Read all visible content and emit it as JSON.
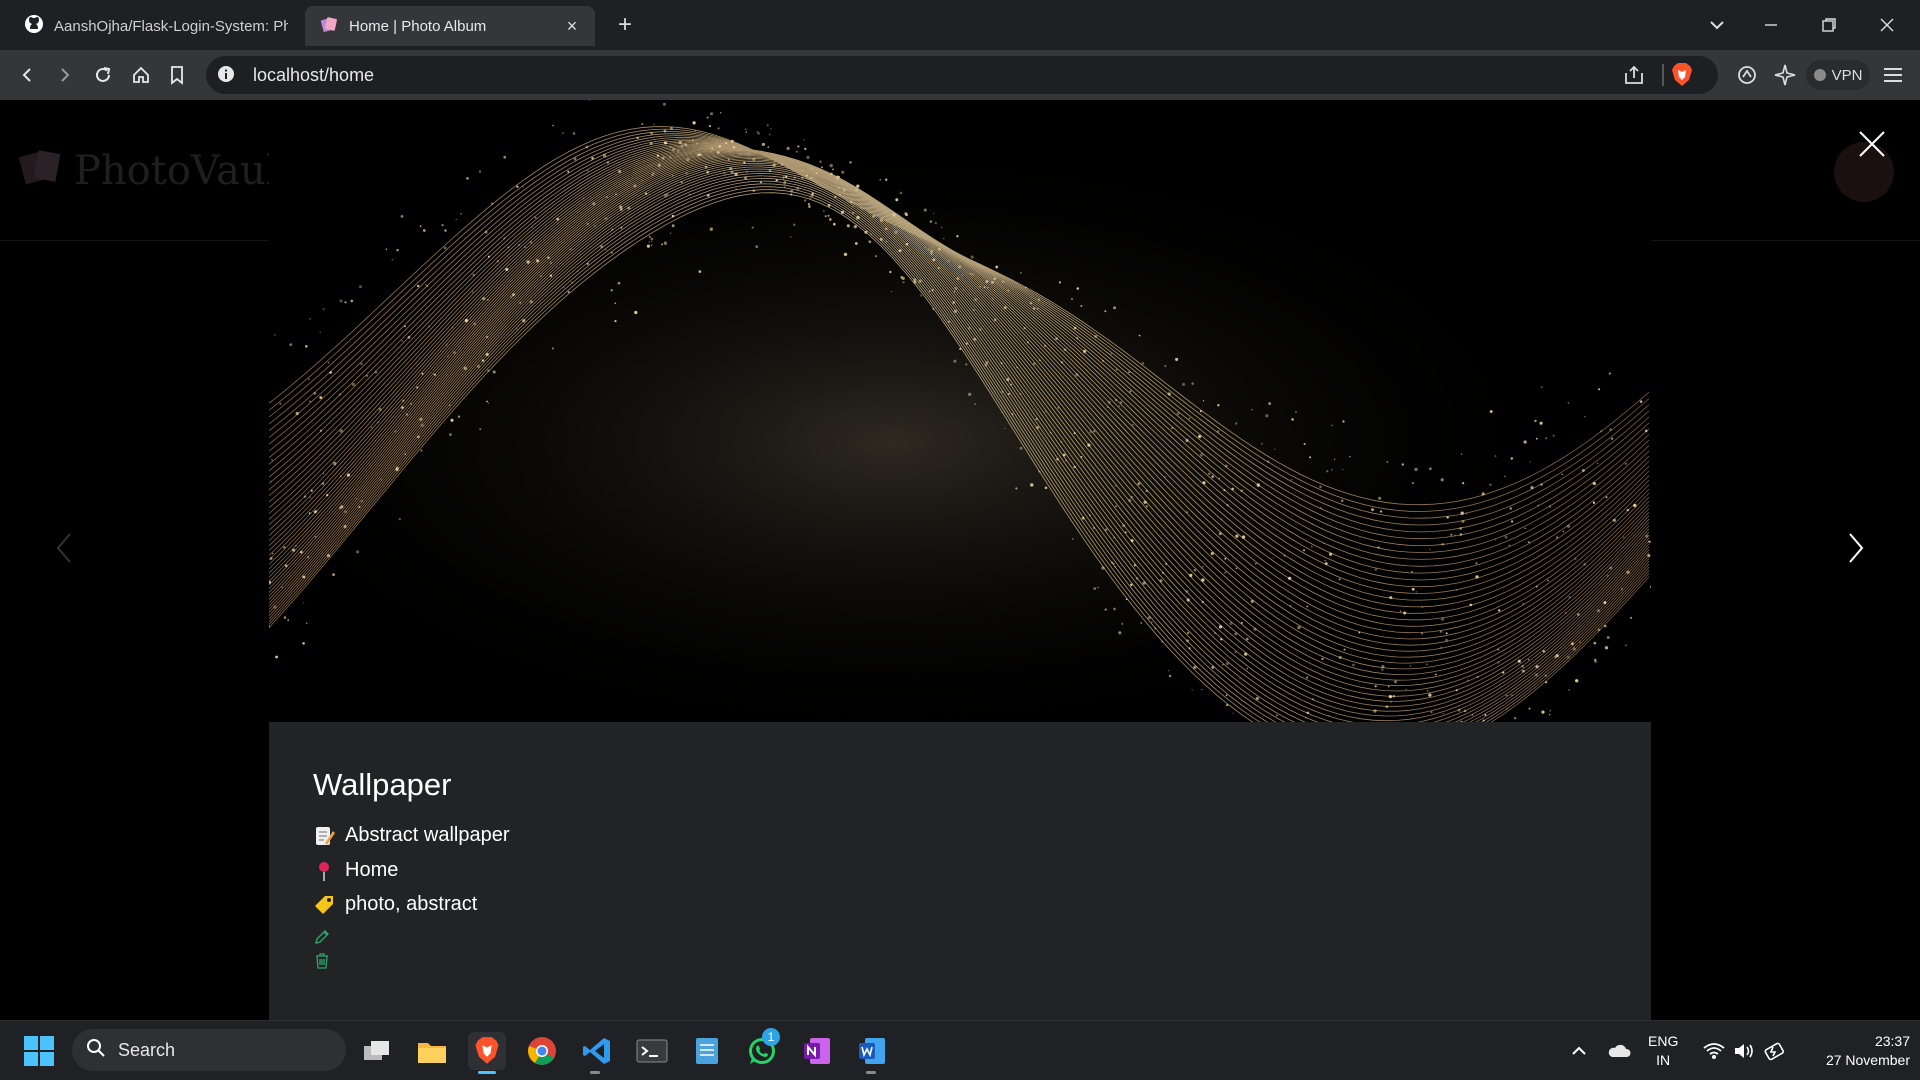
{
  "browser": {
    "tabs": [
      {
        "title": "AanshOjha/Flask-Login-System: Photo",
        "active": false
      },
      {
        "title": "Home | Photo Album",
        "active": true
      }
    ],
    "url": "localhost/home",
    "vpn_label": "VPN"
  },
  "site": {
    "logo_text": "PhotoVault"
  },
  "photo": {
    "title": "Wallpaper",
    "description": "Abstract wallpaper",
    "location": "Home",
    "tags": "photo, abstract"
  },
  "taskbar": {
    "search_placeholder": "Search",
    "whatsapp_badge": "1",
    "language_line1": "ENG",
    "language_line2": "IN",
    "time": "23:37",
    "date": "27 November"
  },
  "colors": {
    "chrome_bg": "#35363a",
    "tabbar_bg": "#1f2023",
    "info_panel_bg": "#222325",
    "action_icon": "#2ea36b",
    "brave_orange": "#fb542b",
    "wave_gold": "#e8c07a"
  }
}
